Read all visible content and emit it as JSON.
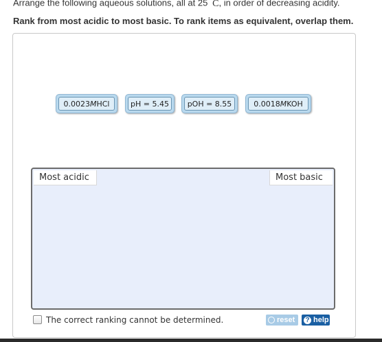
{
  "instructions": {
    "line1_prefix": "Arrange the following aqueous solutions, all at 25 ",
    "degree": "°",
    "temp_unit": "C",
    "line1_suffix": ", in order of decreasing acidity.",
    "line2": "Rank from most acidic to most basic. To rank items as equivalent, overlap them."
  },
  "tiles": [
    {
      "prefix": "0.0023 ",
      "unit": "M",
      "suffix": " HCl"
    },
    {
      "prefix": "pH = 5.45",
      "unit": "",
      "suffix": ""
    },
    {
      "prefix": "pOH = 8.55",
      "unit": "",
      "suffix": ""
    },
    {
      "prefix": "0.0018 ",
      "unit": "M",
      "suffix": " KOH"
    }
  ],
  "ranking": {
    "left_label": "Most acidic",
    "right_label": "Most basic"
  },
  "cannot_determine": {
    "label": "The correct ranking cannot be determined.",
    "checked": false
  },
  "buttons": {
    "reset_label": "reset",
    "help_label": "help",
    "help_icon": "?"
  },
  "colors": {
    "tile_outer": "#b9d9ee",
    "tile_inner": "#dfeef8",
    "rank_area": "#e8eefb",
    "help_button": "#1a5fa3",
    "reset_button": "#a8cbe6"
  }
}
